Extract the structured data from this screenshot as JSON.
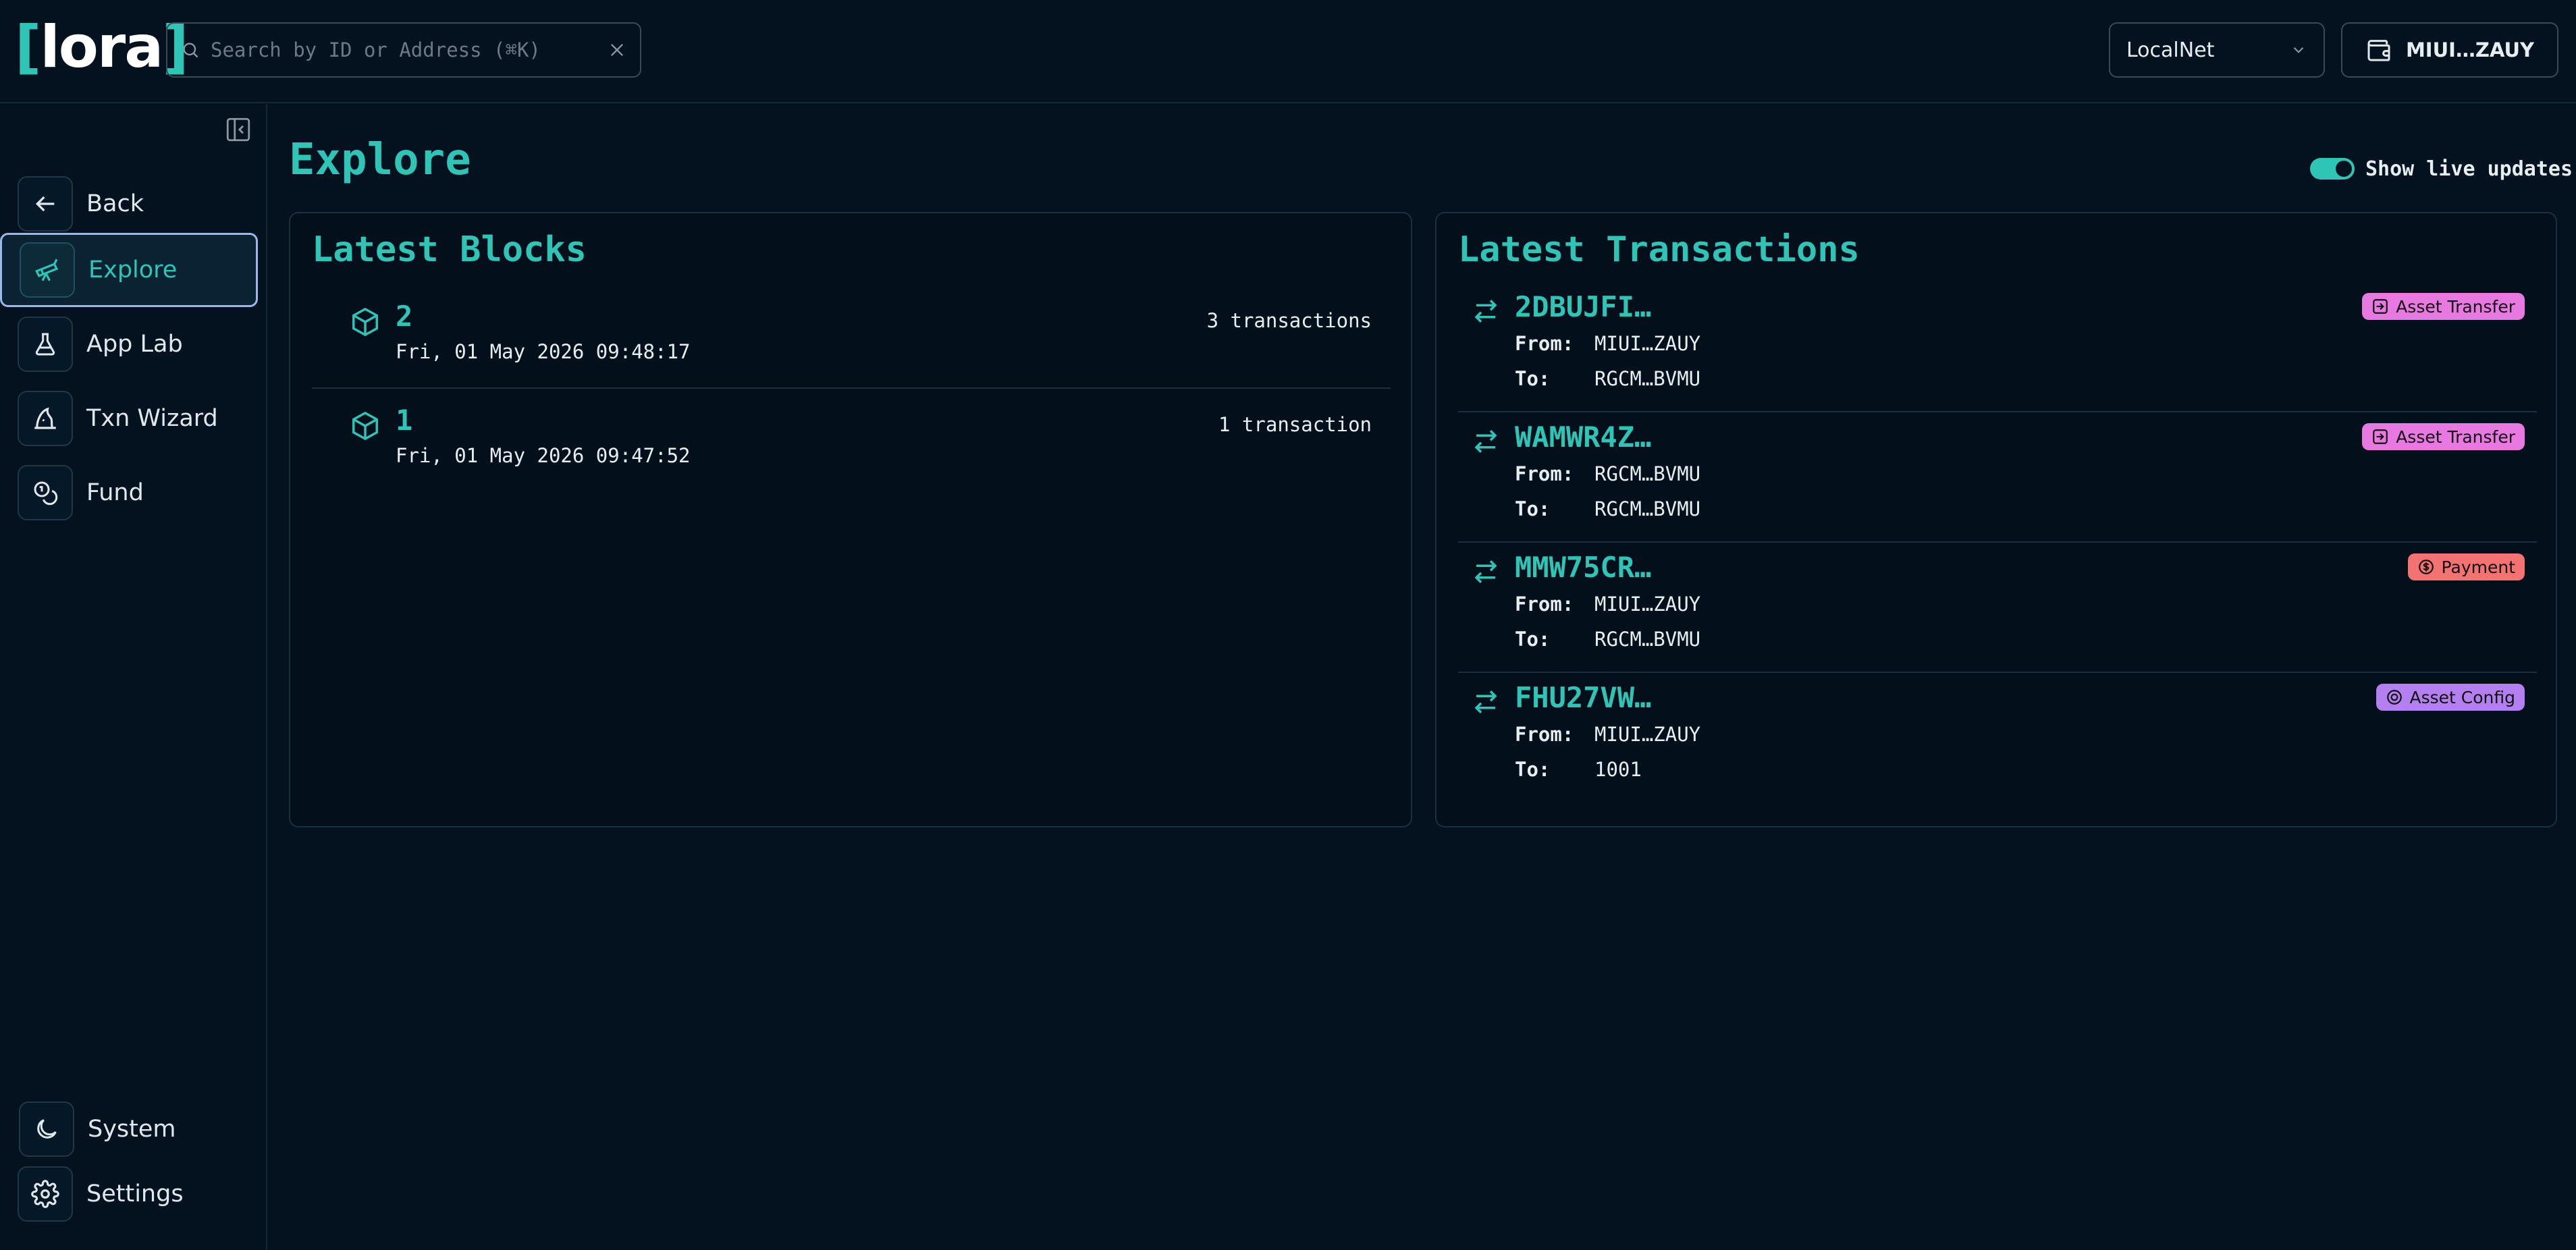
{
  "header": {
    "logo": {
      "bracket_open": "[",
      "text": "lora",
      "bracket_close": "]"
    },
    "search": {
      "placeholder": "Search by ID or Address (⌘K)",
      "value": ""
    },
    "network": {
      "selected": "LocalNet"
    },
    "wallet": {
      "label": "MIUI…ZAUY"
    }
  },
  "sidebar": {
    "items": [
      {
        "label": "Back",
        "icon": "arrow-left-icon"
      },
      {
        "label": "Explore",
        "icon": "telescope-icon",
        "active": true
      },
      {
        "label": "App Lab",
        "icon": "flask-icon"
      },
      {
        "label": "Txn Wizard",
        "icon": "wizard-hat-icon"
      },
      {
        "label": "Fund",
        "icon": "coins-icon"
      }
    ],
    "bottom": [
      {
        "label": "System",
        "icon": "moon-icon"
      },
      {
        "label": "Settings",
        "icon": "gear-icon"
      }
    ]
  },
  "main": {
    "title": "Explore",
    "live_updates": {
      "label": "Show live updates",
      "enabled": true
    },
    "latest_blocks": {
      "title": "Latest Blocks",
      "items": [
        {
          "number": "2",
          "date": "Fri, 01 May 2026 09:48:17",
          "count": "3 transactions"
        },
        {
          "number": "1",
          "date": "Fri, 01 May 2026 09:47:52",
          "count": "1 transaction"
        }
      ]
    },
    "latest_transactions": {
      "title": "Latest Transactions",
      "from_label": "From:",
      "to_label": "To:",
      "items": [
        {
          "id": "2DBUJFI…",
          "from": "MIUI…ZAUY",
          "to": "RGCM…BVMU",
          "type": "Asset Transfer"
        },
        {
          "id": "WAMWR4Z…",
          "from": "RGCM…BVMU",
          "to": "RGCM…BVMU",
          "type": "Asset Transfer"
        },
        {
          "id": "MMW75CR…",
          "from": "MIUI…ZAUY",
          "to": "RGCM…BVMU",
          "type": "Payment"
        },
        {
          "id": "FHU27VW…",
          "from": "MIUI…ZAUY",
          "to": "1001",
          "type": "Asset Config"
        }
      ]
    }
  },
  "colors": {
    "accent": "#2ec4b6",
    "background": "#04121f",
    "asset_transfer": "#e879e0",
    "payment": "#f47272",
    "asset_config": "#b47ff0",
    "active_border": "#9db8e8"
  }
}
